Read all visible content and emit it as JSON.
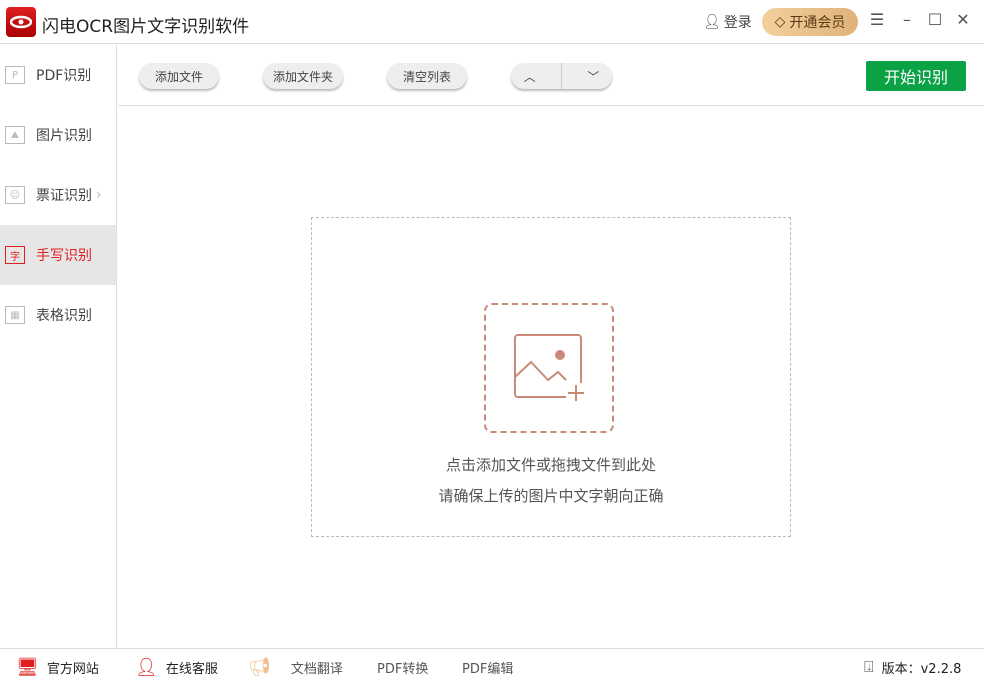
{
  "app": {
    "title": "闪电OCR图片文字识别软件",
    "login": "登录",
    "vip": "开通会员"
  },
  "sidebar": {
    "items": [
      {
        "label": "PDF识别"
      },
      {
        "label": "图片识别"
      },
      {
        "label": "票证识别"
      },
      {
        "label": "手写识别"
      },
      {
        "label": "表格识别"
      }
    ]
  },
  "toolbar": {
    "add_file": "添加文件",
    "add_folder": "添加文件夹",
    "clear_list": "清空列表",
    "start": "开始识别"
  },
  "drop": {
    "line1": "点击添加文件或拖拽文件到此处",
    "line2": "请确保上传的图片中文字朝向正确"
  },
  "footer": {
    "website": "官方网站",
    "service": "在线客服",
    "translate": "文档翻译",
    "pdf_convert": "PDF转换",
    "pdf_edit": "PDF编辑",
    "version": "版本：v2.2.8"
  }
}
